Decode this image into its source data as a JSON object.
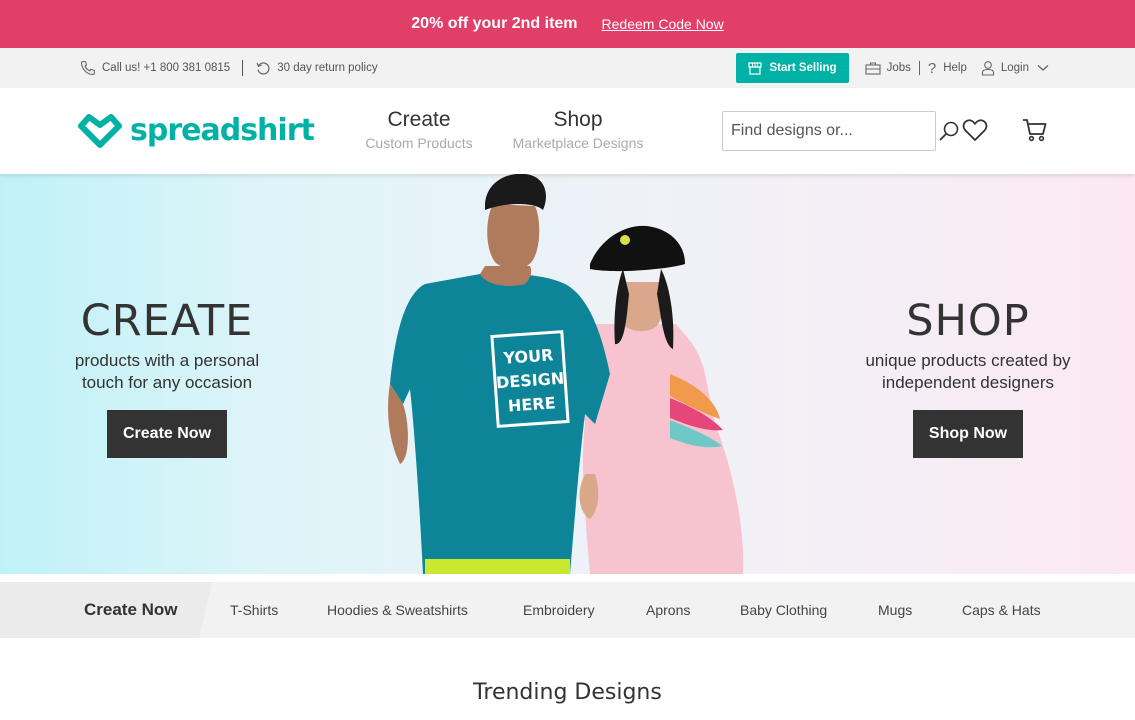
{
  "promo": {
    "text": "20% off your 2nd item",
    "link": "Redeem Code Now",
    "bg": "#e13e68"
  },
  "utility": {
    "phone": "Call us! +1 800 381 0815",
    "returns": "30 day return policy",
    "start_selling": "Start Selling",
    "jobs": "Jobs",
    "help": "Help",
    "login": "Login"
  },
  "header": {
    "logo": "spreadshirt",
    "nav": [
      {
        "title": "Create",
        "sub": "Custom Products"
      },
      {
        "title": "Shop",
        "sub": "Marketplace Designs"
      }
    ],
    "search_placeholder": "Find designs or..."
  },
  "hero": {
    "left": {
      "heading": "CREATE",
      "line1": "products with a personal",
      "line2": "touch for any occasion",
      "button": "Create Now"
    },
    "right": {
      "heading": "SHOP",
      "line1": "unique products created by",
      "line2": "independent designers",
      "button": "Shop Now"
    },
    "shirt_print": [
      "YOUR",
      "DESIGN",
      "HERE"
    ]
  },
  "categories": {
    "lead": "Create Now",
    "items": [
      "T-Shirts",
      "Hoodies & Sweatshirts",
      "Embroidery",
      "Aprons",
      "Baby Clothing",
      "Mugs",
      "Caps & Hats"
    ]
  },
  "section_title": "Trending Designs",
  "colors": {
    "brand": "#00b2a5",
    "promo": "#e13e68",
    "dark": "#333333"
  }
}
